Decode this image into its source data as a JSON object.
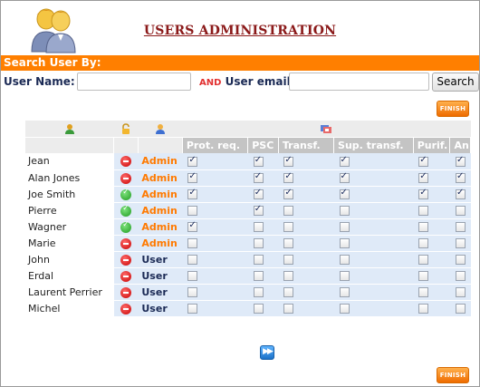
{
  "header": {
    "title": "USERS ADMINISTRATION",
    "logo_icon": "users-group-icon"
  },
  "search": {
    "bar_title": "Search User By:",
    "username_label": "User Name:",
    "username_value": "",
    "and_label": "AND",
    "email_label": "User email:",
    "email_value": "",
    "button_label": "Search"
  },
  "buttons": {
    "finish_top": "FINISH",
    "finish_bottom": "FINISH",
    "next_icon": "fast-forward-icon"
  },
  "table": {
    "header_icons": {
      "user": "user-icon",
      "lock": "lock-icon",
      "admin": "admin-person-icon",
      "permissions": "permissions-icon"
    },
    "columns": [
      "Prot. req.",
      "PSC",
      "Transf.",
      "Sup. transf.",
      "Purif.",
      "An."
    ],
    "rows": [
      {
        "name": "Jean",
        "status": "blocked",
        "role": "Admin",
        "perms": [
          true,
          true,
          true,
          true,
          true,
          true
        ]
      },
      {
        "name": "Alan Jones",
        "status": "blocked",
        "role": "Admin",
        "perms": [
          true,
          true,
          true,
          true,
          true,
          true
        ]
      },
      {
        "name": "Joe Smith",
        "status": "active",
        "role": "Admin",
        "perms": [
          true,
          true,
          true,
          true,
          true,
          true
        ]
      },
      {
        "name": "Pierre",
        "status": "active",
        "role": "Admin",
        "perms": [
          false,
          true,
          false,
          false,
          false,
          false
        ]
      },
      {
        "name": "Wagner",
        "status": "active",
        "role": "Admin",
        "perms": [
          true,
          false,
          false,
          false,
          false,
          false
        ]
      },
      {
        "name": "Marie",
        "status": "blocked",
        "role": "Admin",
        "perms": [
          false,
          false,
          false,
          false,
          false,
          false
        ]
      },
      {
        "name": "John",
        "status": "blocked",
        "role": "User",
        "perms": [
          false,
          false,
          false,
          false,
          false,
          false
        ]
      },
      {
        "name": "Erdal",
        "status": "blocked",
        "role": "User",
        "perms": [
          false,
          false,
          false,
          false,
          false,
          false
        ]
      },
      {
        "name": "Laurent Perrier",
        "status": "blocked",
        "role": "User",
        "perms": [
          false,
          false,
          false,
          false,
          false,
          false
        ]
      },
      {
        "name": "Michel",
        "status": "blocked",
        "role": "User",
        "perms": [
          false,
          false,
          false,
          false,
          false,
          false
        ]
      }
    ]
  },
  "colors": {
    "accent": "#ff7f00",
    "title": "#8b1a1a",
    "row_tint": "#dfeaf8"
  }
}
